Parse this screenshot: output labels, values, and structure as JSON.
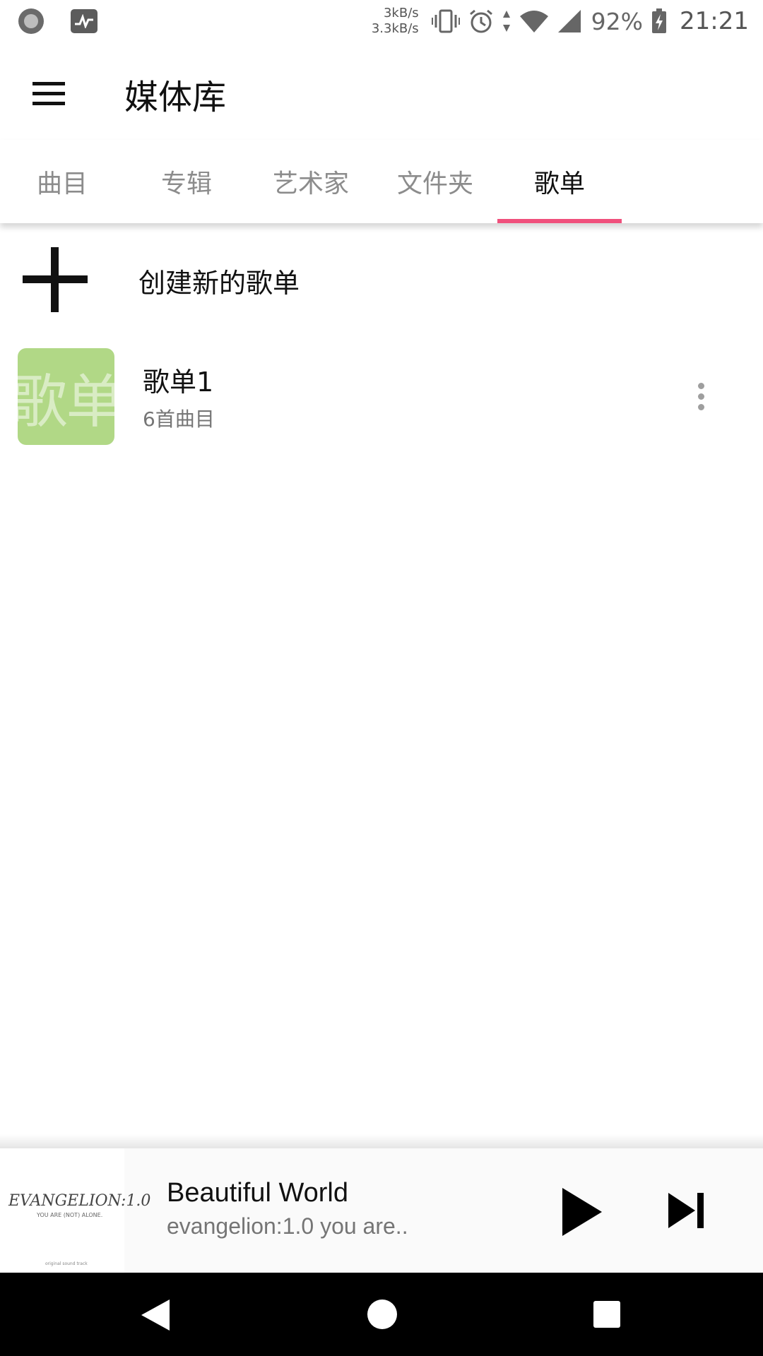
{
  "status_bar": {
    "speed_up": "3kB/s",
    "speed_down": "3.3kB/s",
    "battery": "92%",
    "time": "21:21",
    "icons": [
      "record-circle-icon",
      "activity-icon",
      "vibrate-icon",
      "alarm-icon",
      "data-arrows-icon",
      "wifi-icon",
      "signal-icon",
      "battery-charging-icon"
    ]
  },
  "app_bar": {
    "title": "媒体库",
    "menu_icon": "hamburger-menu-icon"
  },
  "tabs": [
    {
      "label": "曲目",
      "active": false
    },
    {
      "label": "专辑",
      "active": false
    },
    {
      "label": "艺术家",
      "active": false
    },
    {
      "label": "文件夹",
      "active": false
    },
    {
      "label": "歌单",
      "active": true
    }
  ],
  "accent_color": "#f0507c",
  "create_playlist": {
    "label": "创建新的歌单",
    "icon": "plus-icon"
  },
  "playlists": [
    {
      "thumb_text": "歌单",
      "thumb_color": "#b1d886",
      "name": "歌单1",
      "count": "6首曲目"
    }
  ],
  "now_playing": {
    "album_art_text": "EVANGELION:1.0",
    "album_art_subtitle": "YOU ARE (NOT) ALONE.",
    "album_art_footer": "original sound track",
    "title": "Beautiful World",
    "artist": "evangelion:1.0 you are..",
    "play_icon": "play-icon",
    "next_icon": "skip-next-icon"
  },
  "nav_bar": {
    "back_icon": "back-triangle-icon",
    "home_icon": "home-circle-icon",
    "recents_icon": "recents-square-icon"
  }
}
